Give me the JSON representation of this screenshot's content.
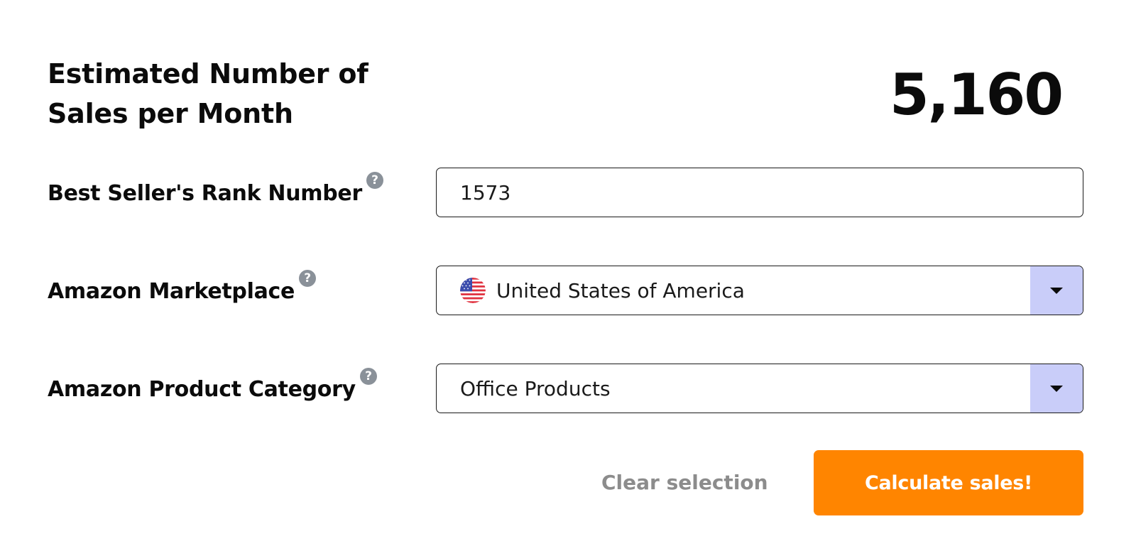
{
  "result": {
    "title": "Estimated Number of Sales per Month",
    "value": "5,160"
  },
  "form": {
    "rank": {
      "label": "Best Seller's Rank Number",
      "value": "1573",
      "help_icon": "question-mark-icon"
    },
    "marketplace": {
      "label": "Amazon Marketplace",
      "selected": "United States of America",
      "flag_icon": "us-flag-icon",
      "help_icon": "question-mark-icon"
    },
    "category": {
      "label": "Amazon Product Category",
      "selected": "Office Products",
      "help_icon": "question-mark-icon"
    }
  },
  "actions": {
    "clear_label": "Clear selection",
    "calculate_label": "Calculate sales!"
  },
  "colors": {
    "accent": "#ff8500",
    "dropdown_toggle": "#c9cdf9",
    "help_icon": "#8a9199",
    "muted_text": "#8c8c8c",
    "text": "#0b0b0b"
  }
}
